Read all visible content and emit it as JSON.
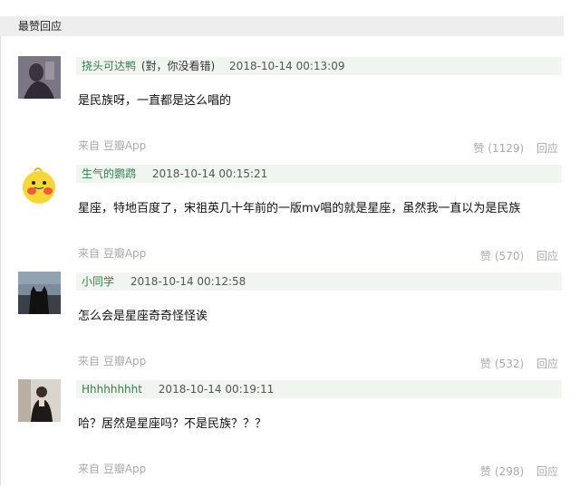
{
  "section": {
    "title": "最赞回应"
  },
  "comments": [
    {
      "username": "挠头可达鸭",
      "note": "(對，你没看错)",
      "timestamp": "2018-10-14 00:13:09",
      "text": "是民族呀，一直都是这么唱的",
      "source": "来自 豆瓣App",
      "like_label": "赞",
      "like_count": "(1129)",
      "reply_label": "回应",
      "avatar": "dark-figure-avatar"
    },
    {
      "username": "生气的鹦鹉",
      "note": "",
      "timestamp": "2018-10-14 00:15:21",
      "text": "星座，特地百度了，宋祖英几十年前的一版mv唱的就是星座，虽然我一直以为是民族",
      "source": "来自 豆瓣App",
      "like_label": "赞",
      "like_count": "(570)",
      "reply_label": "回应",
      "avatar": "yellow-bird-avatar"
    },
    {
      "username": "小同学",
      "note": "",
      "timestamp": "2018-10-14 00:12:58",
      "text": "怎么会是星座奇奇怪怪诶",
      "source": "来自 豆瓣App",
      "like_label": "赞",
      "like_count": "(532)",
      "reply_label": "回应",
      "avatar": "black-cat-avatar"
    },
    {
      "username": "Hhhhhhhht",
      "note": "",
      "timestamp": "2018-10-14 00:19:11",
      "text": "哈？居然是星座吗？不是民族？？？",
      "source": "来自 豆瓣App",
      "like_label": "赞",
      "like_count": "(298)",
      "reply_label": "回应",
      "avatar": "person-photo-avatar"
    }
  ]
}
